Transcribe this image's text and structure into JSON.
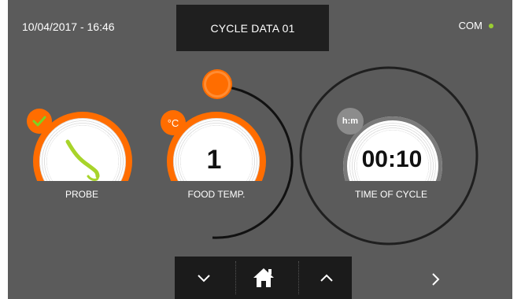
{
  "header": {
    "datetime": "10/04/2017 - 16:46",
    "title": "CYCLE DATA 01",
    "com_label": "COM",
    "com_status_color": "#9acd32"
  },
  "dials": {
    "probe": {
      "label": "PROBE",
      "badge_icon": "checkmark-icon",
      "badge_color": "#ff6d00"
    },
    "food_temp": {
      "label": "FOOD TEMP.",
      "value": "1",
      "unit_badge": "°C"
    },
    "time_of_cycle": {
      "label": "TIME OF CYCLE",
      "value": "00:10",
      "unit_badge": "h:m"
    }
  },
  "nav": {
    "down_icon": "chevron-down-icon",
    "home_icon": "home-icon",
    "up_icon": "chevron-up-icon",
    "next_icon": "chevron-right-icon"
  },
  "colors": {
    "accent": "#ff6d00",
    "background": "#5b5b5b",
    "bar": "#1b1b1b"
  }
}
